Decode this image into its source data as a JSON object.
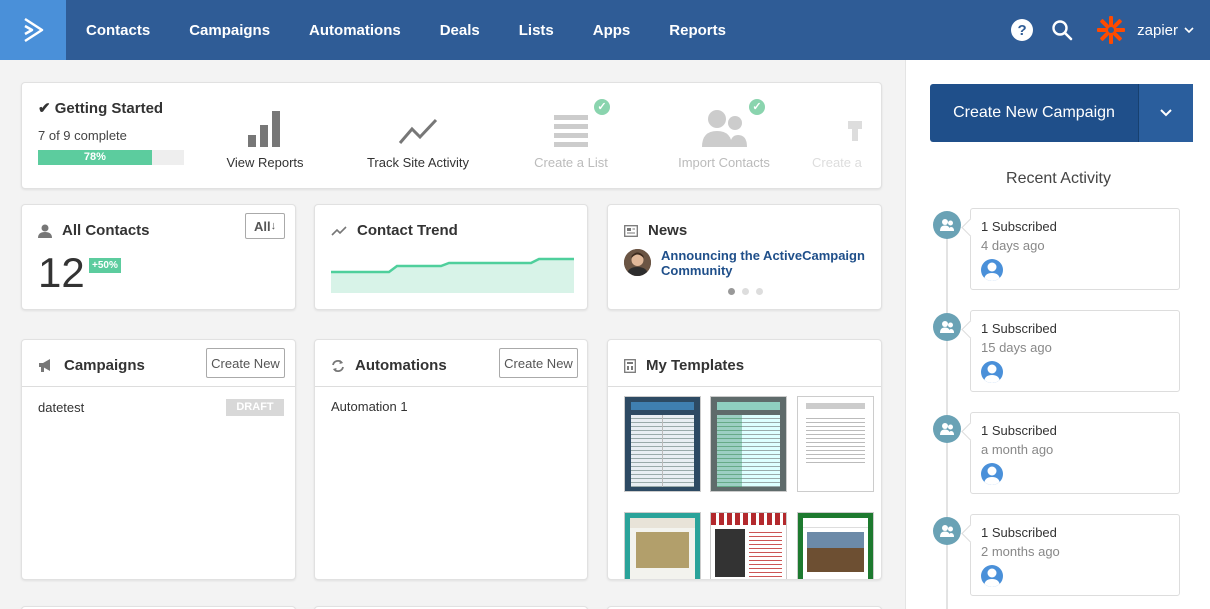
{
  "nav": {
    "items": [
      "Contacts",
      "Campaigns",
      "Automations",
      "Deals",
      "Lists",
      "Apps",
      "Reports"
    ],
    "help_icon": "?",
    "username": "zapier"
  },
  "getting_started": {
    "title": "Getting Started",
    "progress_text": "7 of 9 complete",
    "progress_pct": 78,
    "progress_label": "78%",
    "steps": [
      {
        "label": "View Reports",
        "icon": "bar-chart-icon",
        "done": false
      },
      {
        "label": "Track Site Activity",
        "icon": "line-trend-icon",
        "done": false
      },
      {
        "label": "Create a List",
        "icon": "list-icon",
        "done": true
      },
      {
        "label": "Import Contacts",
        "icon": "users-icon",
        "done": true
      },
      {
        "label": "Create a",
        "icon": "form-icon",
        "done": false
      }
    ]
  },
  "all_contacts": {
    "title": "All Contacts",
    "filter_label": "All",
    "count": "12",
    "delta": "+50%"
  },
  "contact_trend": {
    "title": "Contact Trend"
  },
  "news": {
    "title": "News",
    "headline_line1": "Announcing the ActiveCampaign",
    "headline_line2": "Community"
  },
  "campaigns": {
    "title": "Campaigns",
    "create_label": "Create New",
    "rows": [
      {
        "name": "datetest",
        "status": "DRAFT"
      }
    ]
  },
  "automations": {
    "title": "Automations",
    "create_label": "Create New",
    "rows": [
      {
        "name": "Automation 1"
      }
    ]
  },
  "templates": {
    "title": "My Templates"
  },
  "sidebar": {
    "cta_label": "Create New Campaign",
    "recent_title": "Recent Activity",
    "activities": [
      {
        "text": "1 Subscribed",
        "time": "4 days ago"
      },
      {
        "text": "1 Subscribed",
        "time": "15 days ago"
      },
      {
        "text": "1 Subscribed",
        "time": "a month ago"
      },
      {
        "text": "1 Subscribed",
        "time": "2 months ago"
      }
    ]
  },
  "colors": {
    "nav_bg": "#2f5c96",
    "logo_bg": "#4a90d9",
    "accent_green": "#5ccc9e",
    "cta_bg": "#1f4f8a"
  }
}
